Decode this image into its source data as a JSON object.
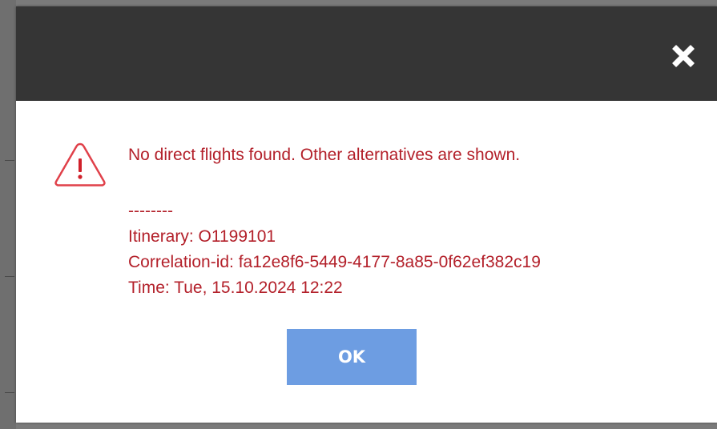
{
  "dialog": {
    "close_icon": "close-icon",
    "warning_icon": "warning-triangle-icon",
    "message": {
      "headline": "No direct flights found. Other alternatives are shown.",
      "separator": "--------",
      "itinerary": "Itinerary: O1199101",
      "correlation_id": "Correlation-id: fa12e8f6-5449-4177-8a85-0f62ef382c19",
      "time": "Time: Tue, 15.10.2024 12:22"
    },
    "ok_label": "OK"
  },
  "colors": {
    "header_bg": "#353535",
    "message_text": "#b3202a",
    "warning_icon": "#e0414a",
    "ok_button_bg": "#6d9de2",
    "backdrop": "#7a7a7a"
  }
}
